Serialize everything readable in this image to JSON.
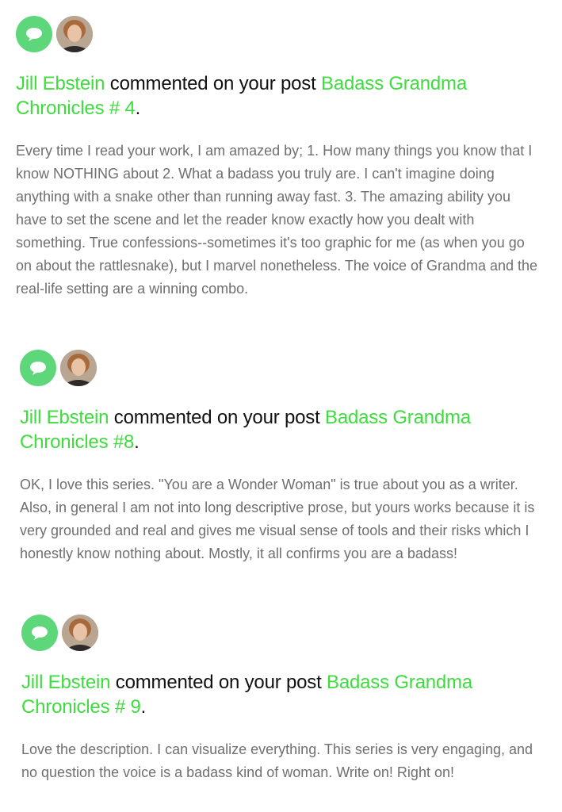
{
  "colors": {
    "accent_link": "#3fdb3f",
    "bubble_icon_bg": "#5ed67a",
    "body_text": "#6f6f6f",
    "headline_text": "#111111"
  },
  "notifications": [
    {
      "icon": "comment-bubble-icon",
      "avatar": "user-avatar",
      "author": "Jill Ebstein",
      "action": " commented on your post ",
      "post_title": "Badass Grandma Chronicles # 4",
      "period": ".",
      "comment": "Every time I read your work, I am amazed by; 1. How many things you know that I know NOTHING about 2. What a badass you truly are. I can't imagine doing anything with a snake other than running away fast. 3. The amazing ability you have to set the scene and let the reader know exactly how you dealt with something. True confessions--sometimes it's too graphic for me (as when you go on about the rattlesnake), but I marvel nonetheless. The voice of Grandma and the real-life setting are a winning combo."
    },
    {
      "icon": "comment-bubble-icon",
      "avatar": "user-avatar",
      "author": "Jill Ebstein",
      "action": " commented on your post ",
      "post_title": "Badass Grandma Chronicles #8",
      "period": ".",
      "comment": "OK, I love this series. \"You are a Wonder Woman\" is true about you as a writer. Also, in general I am not into long descriptive prose, but yours works because it is very grounded and real and gives me visual sense of tools and their risks which I honestly know nothing about. Mostly, it all confirms you are a badass!"
    },
    {
      "icon": "comment-bubble-icon",
      "avatar": "user-avatar",
      "author": "Jill Ebstein",
      "action": " commented on your post ",
      "post_title": "Badass Grandma Chronicles # 9",
      "period": ".",
      "comment": "Love the description. I can visualize everything. This series is very engaging, and no question the voice is a badass kind of woman. Write on! Right on!"
    }
  ]
}
